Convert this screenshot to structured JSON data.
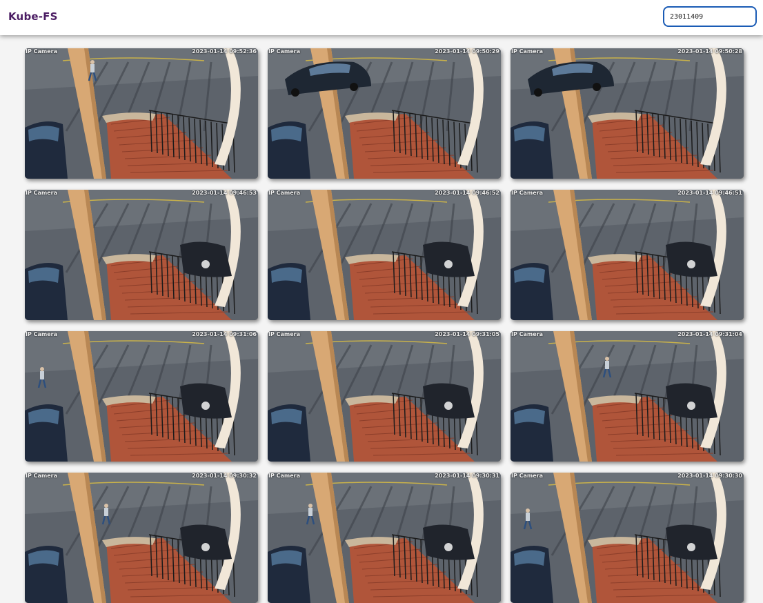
{
  "app": {
    "title": "Kube-FS"
  },
  "search": {
    "value": "23011409"
  },
  "camera_label": "IP Camera",
  "captures": [
    {
      "timestamp": "2023-01-14 09:52:36",
      "parked_car": false,
      "moving_car": false,
      "person": "top"
    },
    {
      "timestamp": "2023-01-14 09:50:29",
      "parked_car": false,
      "moving_car": true,
      "person": "none"
    },
    {
      "timestamp": "2023-01-14 09:50:28",
      "parked_car": false,
      "moving_car": true,
      "person": "none"
    },
    {
      "timestamp": "2023-01-14 09:46:53",
      "parked_car": true,
      "moving_car": false,
      "person": "none"
    },
    {
      "timestamp": "2023-01-14 09:46:52",
      "parked_car": true,
      "moving_car": false,
      "person": "none"
    },
    {
      "timestamp": "2023-01-14 09:46:51",
      "parked_car": true,
      "moving_car": false,
      "person": "none"
    },
    {
      "timestamp": "2023-01-14 09:31:06",
      "parked_car": true,
      "moving_car": false,
      "person": "left"
    },
    {
      "timestamp": "2023-01-14 09:31:05",
      "parked_car": true,
      "moving_car": false,
      "person": "none"
    },
    {
      "timestamp": "2023-01-14 09:31:04",
      "parked_car": true,
      "moving_car": false,
      "person": "mid"
    },
    {
      "timestamp": "2023-01-14 09:30:32",
      "parked_car": true,
      "moving_car": false,
      "person": "center"
    },
    {
      "timestamp": "2023-01-14 09:30:31",
      "parked_car": true,
      "moving_car": false,
      "person": "left-mid"
    },
    {
      "timestamp": "2023-01-14 09:30:30",
      "parked_car": true,
      "moving_car": false,
      "person": "left"
    }
  ],
  "colors": {
    "brand": "#4b1d63",
    "search_border": "#1a5bb5",
    "asphalt": "#5a5f66",
    "brick": "#b0553a",
    "pillar": "#d8a874"
  }
}
